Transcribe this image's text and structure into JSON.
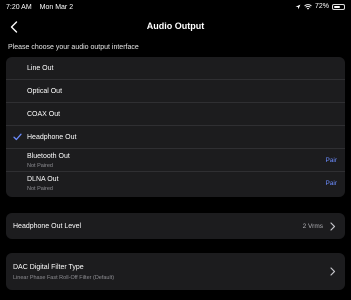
{
  "status_bar": {
    "time": "7:20 AM",
    "date": "Mon Mar 2",
    "battery_label": "72%",
    "battery_level": 0.72,
    "icons": [
      "location-icon",
      "wifi-icon",
      "battery-icon"
    ]
  },
  "nav": {
    "title": "Audio Output",
    "back_icon": "chevron-left-icon"
  },
  "hint": "Please choose your audio output interface",
  "options": [
    {
      "label": "Line Out",
      "sub": "",
      "action": "",
      "selected": false
    },
    {
      "label": "Optical Out",
      "sub": "",
      "action": "",
      "selected": false
    },
    {
      "label": "COAX Out",
      "sub": "",
      "action": "",
      "selected": false
    },
    {
      "label": "Headphone Out",
      "sub": "",
      "action": "",
      "selected": true
    },
    {
      "label": "Bluetooth Out",
      "sub": "Not Paired",
      "action": "Pair",
      "selected": false
    },
    {
      "label": "DLNA Out",
      "sub": "Not Paired",
      "action": "Pair",
      "selected": false
    }
  ],
  "headphone_level": {
    "label": "Headphone Out Level",
    "value": "2 Vrms"
  },
  "dac_filter": {
    "label": "DAC Digital Filter Type",
    "value": "Linear Phase Fast Roll-Off Filter (Default)"
  },
  "colors": {
    "accent": "#6b8cff",
    "background": "#000000",
    "card": "#1c1c1e"
  }
}
